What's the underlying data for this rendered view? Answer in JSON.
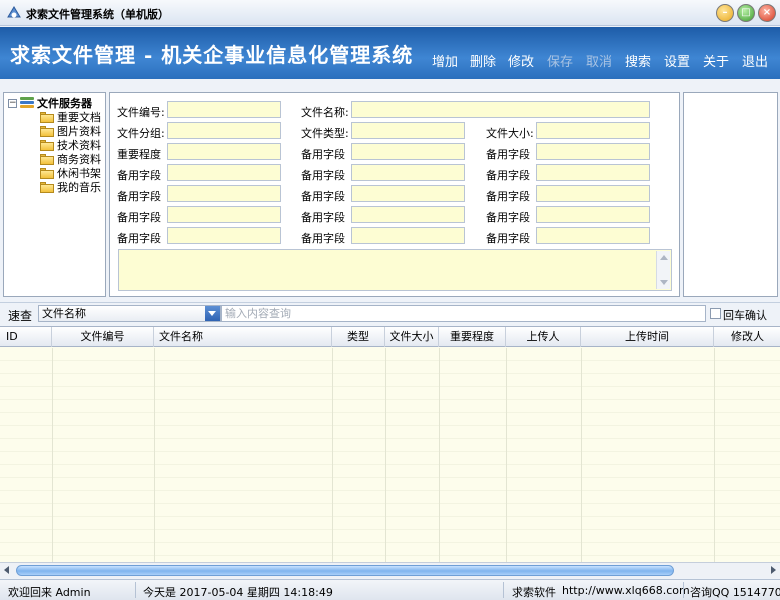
{
  "window": {
    "title": "求索文件管理系统（单机版）"
  },
  "banner": {
    "title": "求索文件管理 - 机关企事业信息化管理系统",
    "menu": [
      "增加",
      "删除",
      "修改",
      "保存",
      "取消",
      "搜索",
      "设置",
      "关于",
      "退出"
    ]
  },
  "tree": {
    "root": "文件服务器",
    "folders": [
      "重要文档",
      "图片资料",
      "技术资料",
      "商务资料",
      "休闲书架",
      "我的音乐"
    ]
  },
  "form": {
    "file_no": "文件编号:",
    "file_name": "文件名称:",
    "file_group": "文件分组:",
    "file_type": "文件类型:",
    "file_size": "文件大小:",
    "importance": "重要程度",
    "spare": "备用字段"
  },
  "search": {
    "label": "速查",
    "field": "文件名称",
    "placeholder": "输入内容查询",
    "enter_confirm": "回车确认"
  },
  "grid": {
    "columns": [
      "ID",
      "文件编号",
      "文件名称",
      "类型",
      "文件大小",
      "重要程度",
      "上传人",
      "上传时间",
      "修改人"
    ]
  },
  "status": {
    "welcome": "欢迎回来 Admin",
    "today": "今天是 2017-05-04 星期四 14:18:49",
    "company": "求索软件",
    "url": "http://www.xlq668.com",
    "qq": "咨询QQ 1514770"
  }
}
